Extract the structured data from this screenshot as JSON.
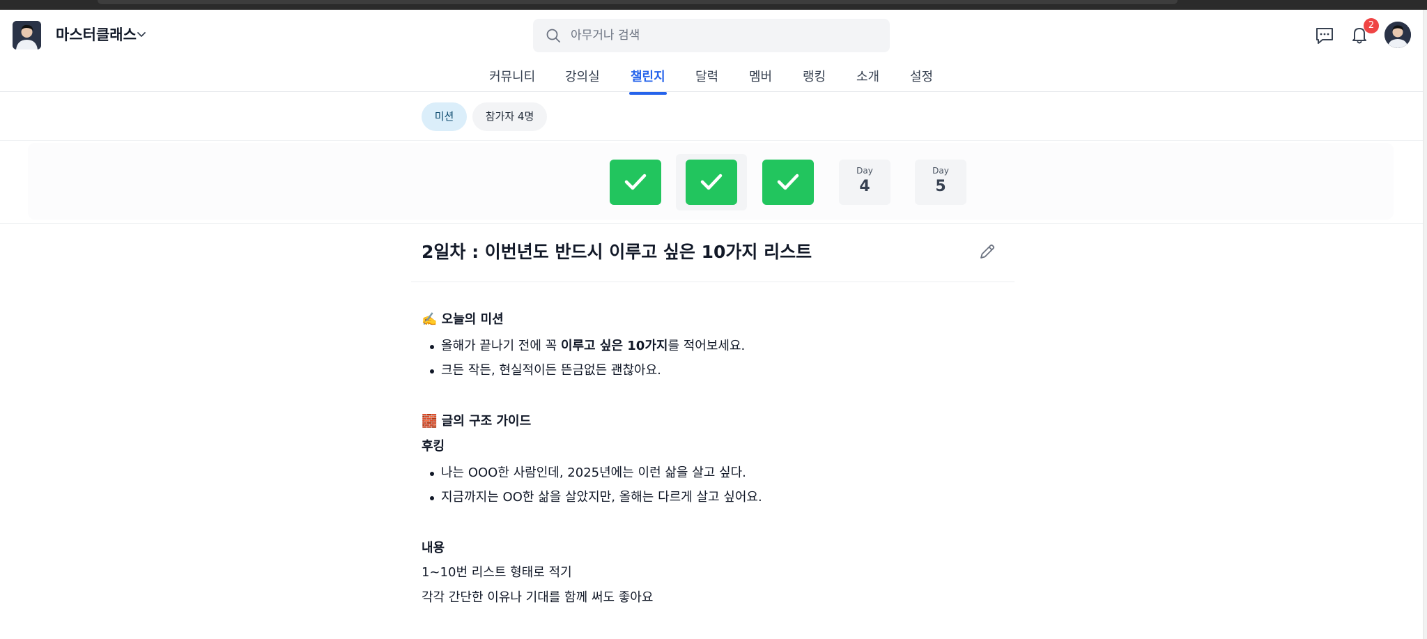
{
  "header": {
    "brand_name": "마스터클래스",
    "search_placeholder": "아무거나 검색",
    "notification_count": "2"
  },
  "tabs": [
    {
      "label": "커뮤니티",
      "active": false
    },
    {
      "label": "강의실",
      "active": false
    },
    {
      "label": "챌린지",
      "active": true
    },
    {
      "label": "달력",
      "active": false
    },
    {
      "label": "멤버",
      "active": false
    },
    {
      "label": "랭킹",
      "active": false
    },
    {
      "label": "소개",
      "active": false
    },
    {
      "label": "설정",
      "active": false
    }
  ],
  "subnav": {
    "mission_label": "미션",
    "participants_label": "참가자 4명"
  },
  "days": [
    {
      "status": "completed",
      "icon": "check-icon"
    },
    {
      "status": "completed",
      "icon": "check-icon"
    },
    {
      "status": "completed",
      "icon": "check-icon"
    },
    {
      "status": "upcoming",
      "label": "Day",
      "number": "4"
    },
    {
      "status": "upcoming",
      "label": "Day",
      "number": "5"
    }
  ],
  "article": {
    "title": "2일차 : 이번년도 반드시 이루고 싶은 10가지 리스트",
    "mission_heading": "✍️ 오늘의 미션",
    "mission_items": [
      {
        "pre": "올해가 끝나기 전에 꼭 ",
        "bold": "이루고 싶은 10가지",
        "post": "를 적어보세요."
      },
      {
        "pre": "크든 작든, 현실적이든 뜬금없든 괜찮아요.",
        "bold": "",
        "post": ""
      }
    ],
    "guide_heading": "🧱 글의 구조 가이드",
    "hooking_heading": "후킹",
    "hooking_items": [
      "나는 OOO한 사람인데, 2025년에는 이런 삶을 살고 싶다.",
      "지금까지는 OO한 삶을 살았지만, 올해는 다르게 살고 싶어요."
    ],
    "content_heading": "내용",
    "content_lines": [
      "1~10번 리스트 형태로 적기",
      "각각 간단한 이유나 기대를 함께 써도 좋아요"
    ]
  },
  "colors": {
    "accent": "#2563eb",
    "completed": "#22c55e",
    "badge": "#ef4444"
  }
}
